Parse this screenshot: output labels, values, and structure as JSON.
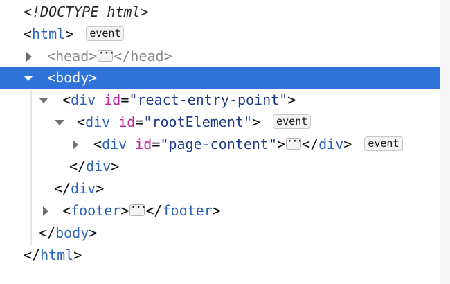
{
  "tree": {
    "doctype": "<!DOCTYPE html>",
    "html_open": "html",
    "html_close": "html",
    "event_label": "event",
    "ellipsis": "···",
    "head": "head",
    "body": "body",
    "footer": "footer",
    "div": "div",
    "id_attr": "id",
    "react_entry_id": "\"react-entry-point\"",
    "root_element_id": "\"rootElement\"",
    "page_content_id": "\"page-content\""
  },
  "colors": {
    "selection": "#2f73d9",
    "tag_name": "#2c63b8",
    "attr_name": "#c81d9a",
    "attr_value": "#1f3c8a"
  }
}
